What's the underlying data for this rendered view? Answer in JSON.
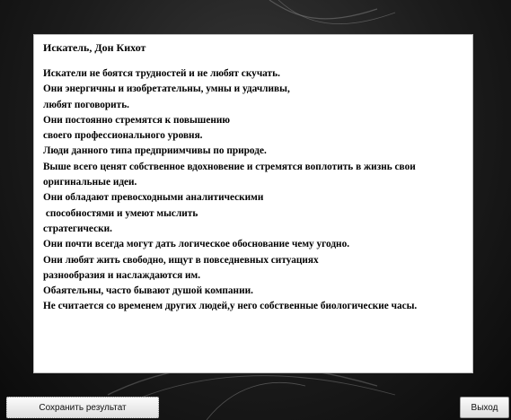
{
  "result": {
    "title": "Искатель, Дон Кихот",
    "lines": [
      "Искатели не боятся трудностей и не любят скучать.",
      "Они энергичны и изобретательны, умны и удачливы,",
      "любят поговорить.",
      "Они постоянно стремятся к повышению",
      "своего профессионального уровня.",
      "Люди данного типа предприимчивы по природе.",
      "Выше всего ценят собственное вдохновение и стремятся воплотить в жизнь свои",
      "оригинальные идеи.",
      "Они обладают превосходными аналитическими",
      " способностями и умеют мыслить",
      "стратегически.",
      "Они почти всегда могут дать логическое обоснование чему угодно.",
      "Они любят жить свободно, ищут в повседневных ситуациях",
      "разнообразия и наслаждаются им.",
      "Обаятельны, часто бывают душой компании.",
      "Не считается со временем других людей,у него собственные биологические часы."
    ]
  },
  "buttons": {
    "save_label": "Сохранить результат",
    "exit_label": "Выход"
  },
  "colors": {
    "background": "#1c1c1c",
    "panel": "#ffffff",
    "text": "#000000"
  }
}
